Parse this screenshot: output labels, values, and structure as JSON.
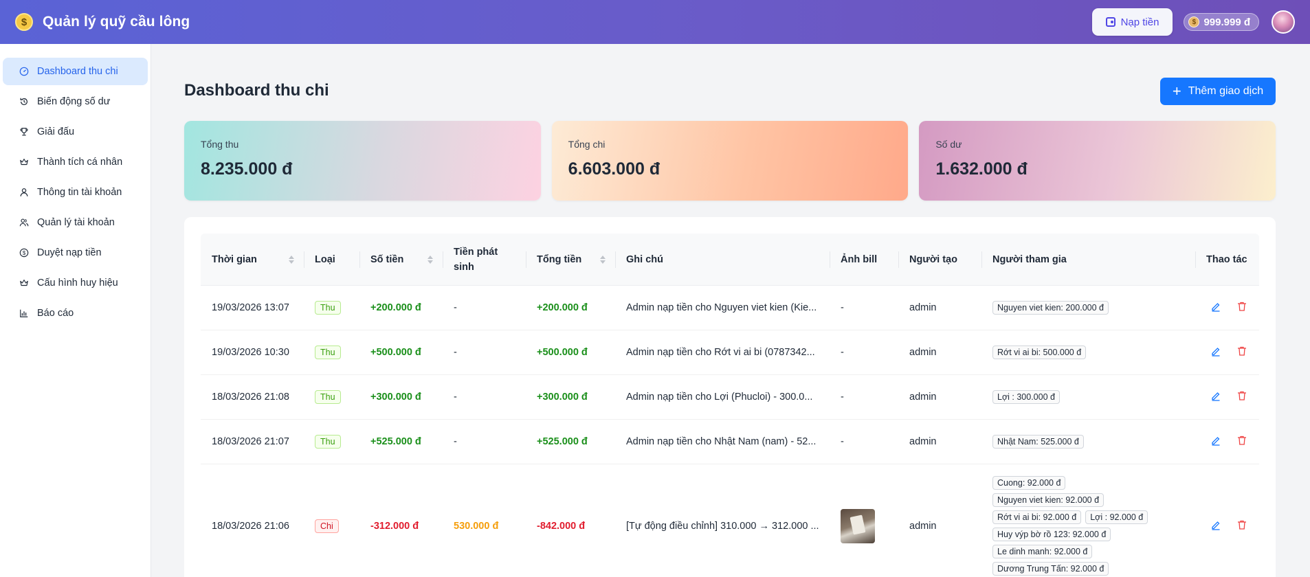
{
  "header": {
    "app_title": "Quản lý quỹ cầu lông",
    "topup_label": "Nạp tiền",
    "balance": "999.999 đ"
  },
  "sidebar": {
    "items": [
      {
        "label": "Dashboard thu chi",
        "icon": "dashboard-icon"
      },
      {
        "label": "Biến động số dư",
        "icon": "history-icon"
      },
      {
        "label": "Giải đấu",
        "icon": "trophy-icon"
      },
      {
        "label": "Thành tích cá nhân",
        "icon": "crown-icon"
      },
      {
        "label": "Thông tin tài khoản",
        "icon": "user-icon"
      },
      {
        "label": "Quản lý tài khoản",
        "icon": "users-icon"
      },
      {
        "label": "Duyệt nạp tiền",
        "icon": "dollar-icon"
      },
      {
        "label": "Cấu hình huy hiệu",
        "icon": "badge-icon"
      },
      {
        "label": "Báo cáo",
        "icon": "chart-icon"
      }
    ]
  },
  "main": {
    "title": "Dashboard thu chi",
    "add_button": "Thêm giao dịch",
    "stats": {
      "income_label": "Tổng thu",
      "income_value": "8.235.000 đ",
      "expense_label": "Tổng chi",
      "expense_value": "6.603.000 đ",
      "balance_label": "Số dư",
      "balance_value": "1.632.000 đ"
    },
    "table": {
      "columns": {
        "time": "Thời gian",
        "type": "Loại",
        "amount": "Số tiền",
        "extra_1": "Tiền phát",
        "extra_2": "sinh",
        "total": "Tổng tiền",
        "note": "Ghi chú",
        "bill": "Ảnh bill",
        "creator": "Người tạo",
        "participants": "Người tham gia",
        "actions": "Thao tác"
      },
      "rows": [
        {
          "time": "19/03/2026 13:07",
          "type": "Thu",
          "amount": "+200.000 đ",
          "extra": "-",
          "total": "+200.000 đ",
          "note": "Admin nạp tiền cho Nguyen viet kien (Kie...",
          "bill": "-",
          "creator": "admin",
          "participants": [
            "Nguyen viet kien: 200.000 đ"
          ]
        },
        {
          "time": "19/03/2026 10:30",
          "type": "Thu",
          "amount": "+500.000 đ",
          "extra": "-",
          "total": "+500.000 đ",
          "note": "Admin nạp tiền cho Rớt vi ai bi (0787342...",
          "bill": "-",
          "creator": "admin",
          "participants": [
            "Rớt vi ai bi: 500.000 đ"
          ]
        },
        {
          "time": "18/03/2026 21:08",
          "type": "Thu",
          "amount": "+300.000 đ",
          "extra": "-",
          "total": "+300.000 đ",
          "note": "Admin nạp tiền cho Lợi (Phucloi) - 300.0...",
          "bill": "-",
          "creator": "admin",
          "participants": [
            "Lợi : 300.000 đ"
          ]
        },
        {
          "time": "18/03/2026 21:07",
          "type": "Thu",
          "amount": "+525.000 đ",
          "extra": "-",
          "total": "+525.000 đ",
          "note": "Admin nạp tiền cho Nhật Nam (nam) - 52...",
          "bill": "-",
          "creator": "admin",
          "participants": [
            "Nhật Nam: 525.000 đ"
          ]
        },
        {
          "time": "18/03/2026 21:06",
          "type": "Chi",
          "amount": "-312.000 đ",
          "extra": "530.000 đ",
          "total": "-842.000 đ",
          "note": "[Tự động điều chỉnh] 310.000 → 312.000 ...",
          "bill": "",
          "creator": "admin",
          "participants": [
            "Cuong: 92.000 đ",
            "Nguyen viet kien: 92.000 đ",
            "Rớt vi ai bi: 92.000 đ",
            "Lợi : 92.000 đ",
            "Huy výp bờ rồ 123: 92.000 đ",
            "Le dinh manh: 92.000 đ",
            "Dương Trung Tấn: 92.000 đ"
          ]
        }
      ]
    }
  },
  "colors": {
    "primary": "#1677ff",
    "income_green": "#1a8f1a",
    "expense_red": "#e11d2e",
    "fee_orange": "#f59e0b"
  }
}
